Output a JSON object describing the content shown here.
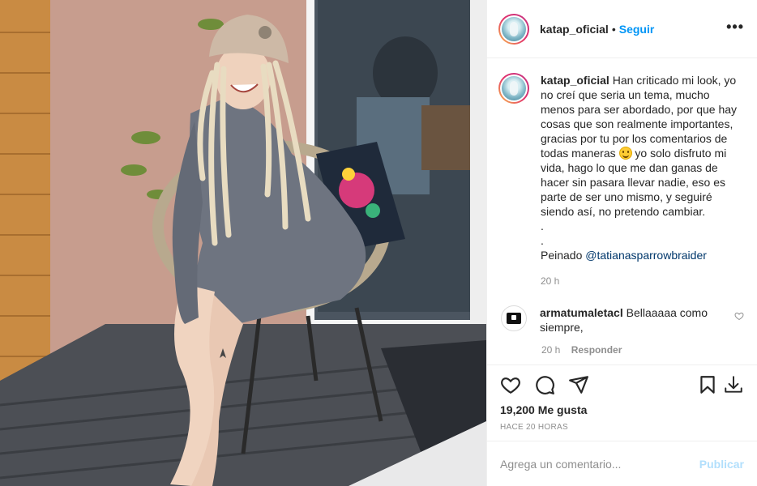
{
  "post": {
    "photo_label": "photo",
    "header": {
      "username": "katap_oficial",
      "separator": "•",
      "follow_label": "Seguir",
      "more_icon": "more-horizontal-icon"
    },
    "caption": {
      "username": "katap_oficial",
      "lines": [
        "Han criticado mi look, yo",
        "no creí que seria un tema, mucho",
        "menos para ser abordado, por que hay",
        "cosas que son realmente importantes,",
        "gracias por tu por los comentarios de"
      ],
      "line_emoji_before": "todas maneras",
      "line_emoji_after": "yo solo disfruto mi",
      "lines_after": [
        "vida, hago lo que me dan ganas de",
        "hacer sin pasara llevar nadie, eso es",
        "parte de ser uno mismo, y seguiré",
        "siendo así, no pretendo cambiar.",
        ".",
        "."
      ],
      "credit_prefix": "Peinado",
      "mention": "@tatianasparrowbraider",
      "time": "20 h"
    },
    "comment": {
      "username": "armatumaletacl",
      "text_line1": "Bellaaaaa como",
      "text_line2": "siempre,",
      "time": "20 h",
      "reply_label": "Responder"
    },
    "likes": "19,200 Me gusta",
    "posted_ago": "HACE 20 HORAS",
    "add_comment": {
      "placeholder": "Agrega un comentario...",
      "publish_label": "Publicar"
    },
    "colors": {
      "link": "#0095f6",
      "publish_disabled": "#b2dffc",
      "mention": "#00376b",
      "muted": "#8e8e8e"
    }
  }
}
